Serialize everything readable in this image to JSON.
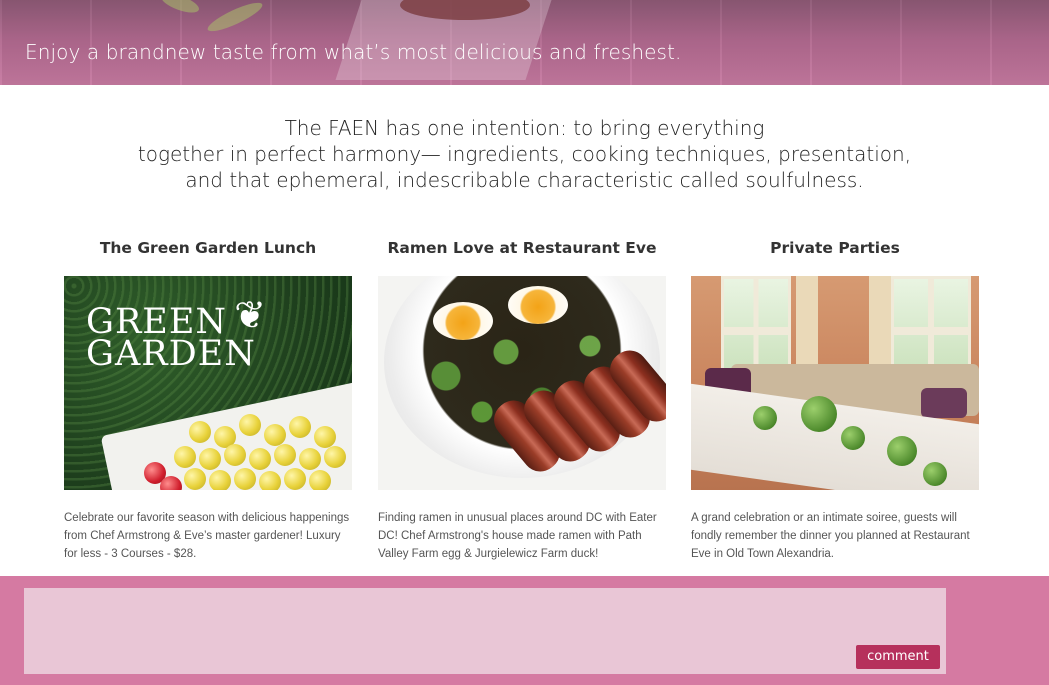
{
  "hero": {
    "tagline": "Enjoy a brandnew taste from what’s most delicious and freshest."
  },
  "intro": {
    "lines": [
      "The FAEN has one intention: to bring everything",
      "together in perfect harmony— ingredients, cooking techniques, presentation,",
      "and that ephemeral, indescribable characteristic called soulfulness."
    ]
  },
  "cards": [
    {
      "title": "The Green Garden Lunch",
      "image_logo": "GREEN GARDEN",
      "image_logo_line1": "GREEN",
      "image_logo_line2": "GARDEN",
      "image_name": "green-garden-image",
      "description": "Celebrate our favorite season with delicious happenings from Chef Armstrong & Eve’s master gardener! Luxury for less - 3 Courses - $28."
    },
    {
      "title": "Ramen Love at Restaurant Eve",
      "image_name": "ramen-bowl-image",
      "description": "Finding ramen in unusual places around DC with Eater DC! Chef Armstrong's house made ramen with Path Valley Farm egg & Jurgielewicz Farm duck!"
    },
    {
      "title": "Private Parties",
      "image_name": "private-dining-room-image",
      "description": "A grand celebration or an intimate soiree, guests will fondly remember the dinner you planned at Restaurant Eve in Old Town Alexandria."
    }
  ],
  "comment": {
    "placeholder": "",
    "value": "",
    "button_label": "comment"
  },
  "colors": {
    "accent_pink": "#d57aa2",
    "textarea_bg": "#e9c6d6",
    "button_bg": "#b6305c"
  }
}
